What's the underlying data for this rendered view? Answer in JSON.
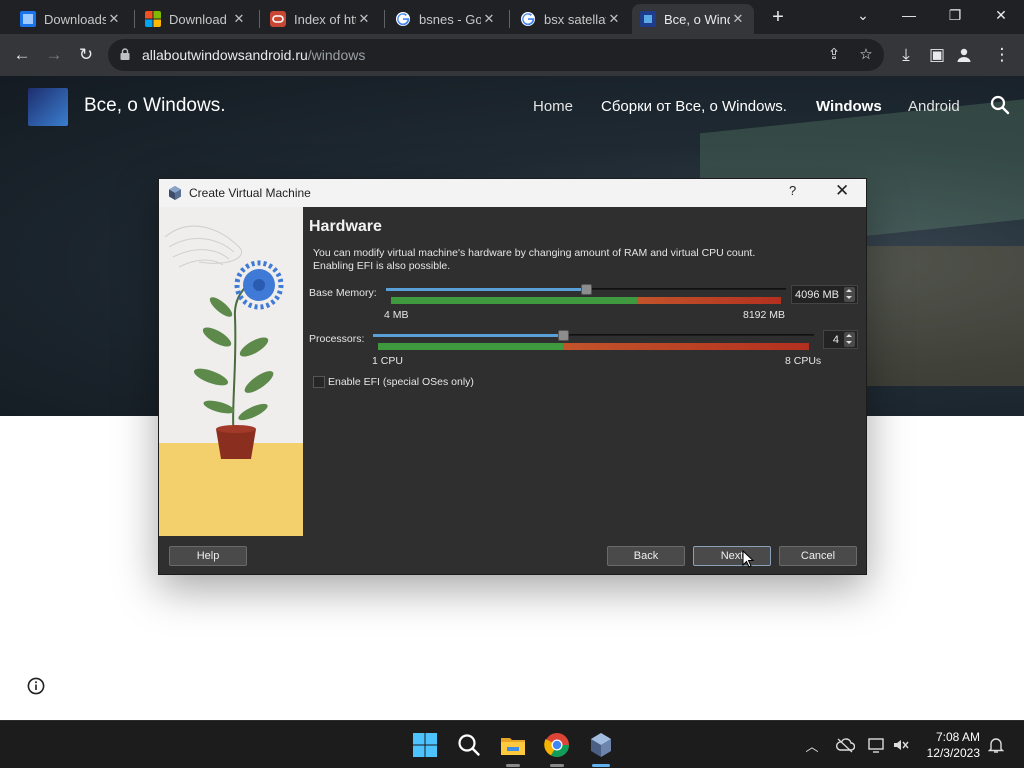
{
  "browser": {
    "tabs": [
      {
        "title": "Downloads",
        "icon": "windows-tile-icon",
        "active": false
      },
      {
        "title": "Download",
        "icon": "microsoft-icon",
        "active": false
      },
      {
        "title": "Index of htt",
        "icon": "oracle-icon",
        "active": false
      },
      {
        "title": "bsnes - Goo",
        "icon": "google-icon",
        "active": false
      },
      {
        "title": "bsx satellav",
        "icon": "google-icon",
        "active": false
      },
      {
        "title": "Все, о Wind",
        "icon": "site-logo-icon",
        "active": true
      }
    ],
    "address": {
      "host": "allaboutwindowsandroid.ru",
      "path": "/windows"
    }
  },
  "site": {
    "name": "Все, о Windows.",
    "nav": [
      "Home",
      "Сборки от Все, о Windows.",
      "Windows",
      "Android"
    ],
    "active_nav": "Windows"
  },
  "dialog": {
    "title": "Create Virtual Machine",
    "help_glyph": "?",
    "section_title": "Hardware",
    "description_line1": "You can modify virtual machine's hardware by changing amount of RAM and virtual CPU count.",
    "description_line2": "Enabling EFI is also possible.",
    "memory": {
      "label": "Base Memory:",
      "value": "4096 MB",
      "min_label": "4 MB",
      "max_label": "8192 MB",
      "fraction": 0.5,
      "safe_fraction": 0.63
    },
    "processors": {
      "label": "Processors:",
      "value": "4",
      "min_label": "1 CPU",
      "max_label": "8 CPUs",
      "fraction": 0.43,
      "safe_fraction": 0.43
    },
    "efi_label": "Enable EFI (special OSes only)",
    "efi_checked": false,
    "buttons": {
      "help": "Help",
      "back": "Back",
      "next": "Next",
      "cancel": "Cancel"
    }
  },
  "taskbar": {
    "time": "7:08 AM",
    "date": "12/3/2023"
  },
  "colors": {
    "slider_fill": "#5aa0d8",
    "safe_green": "#3f9a3f",
    "warn_orange": "#c2542b",
    "danger_red": "#b3301f"
  }
}
